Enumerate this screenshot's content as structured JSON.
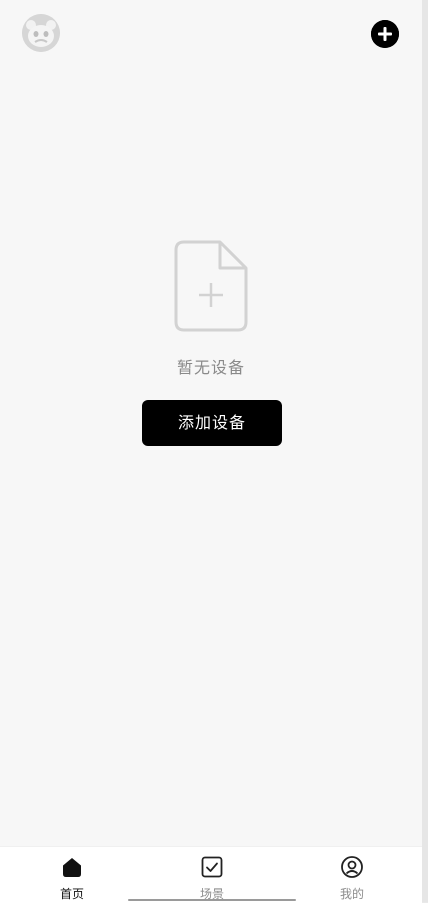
{
  "header": {
    "avatar_icon": "panda-avatar-icon",
    "add_icon": "plus-circle-icon"
  },
  "empty_state": {
    "icon": "file-add-icon",
    "message": "暂无设备",
    "button_label": "添加设备"
  },
  "tabbar": {
    "tabs": [
      {
        "label": "首页",
        "icon": "home-icon",
        "active": true
      },
      {
        "label": "场景",
        "icon": "checkbox-icon",
        "active": false
      },
      {
        "label": "我的",
        "icon": "user-circle-icon",
        "active": false
      }
    ]
  },
  "colors": {
    "background": "#f7f7f7",
    "primary": "#000000",
    "muted_text": "#8a8a8a",
    "tabbar_bg": "#ffffff"
  }
}
